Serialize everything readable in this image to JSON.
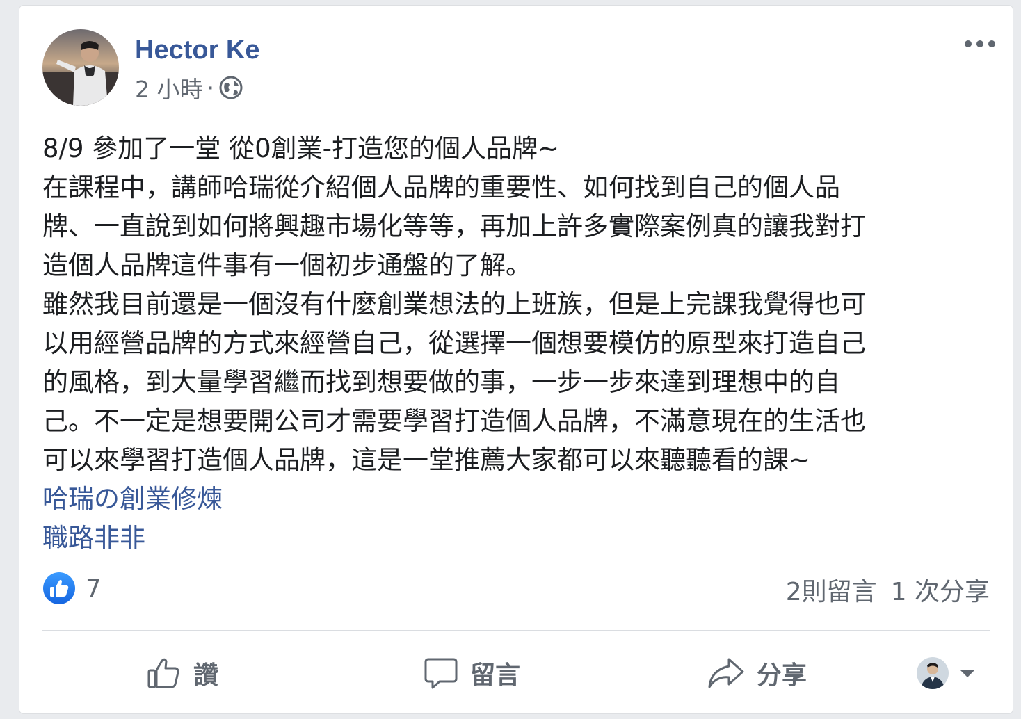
{
  "post": {
    "author": "Hector Ke",
    "time": "2 小時",
    "separator": "·",
    "privacy_icon": "globe-icon",
    "more_icon": "more-options-icon",
    "lines": [
      "8/9 參加了一堂 從0創業-打造您的個人品牌~",
      "在課程中，講師哈瑞從介紹個人品牌的重要性、如何找到自己的個人品",
      "牌、一直說到如何將興趣市場化等等，再加上許多實際案例真的讓我對打",
      "造個人品牌這件事有一個初步通盤的了解。",
      "雖然我目前還是一個沒有什麼創業想法的上班族，但是上完課我覺得也可",
      "以用經營品牌的方式來經營自己，從選擇一個想要模仿的原型來打造自己",
      "的風格，到大量學習繼而找到想要做的事，一步一步來達到理想中的自",
      "己。不一定是想要開公司才需要學習打造個人品牌，不滿意現在的生活也",
      "可以來學習打造個人品牌，這是一堂推薦大家都可以來聽聽看的課~"
    ],
    "tags": [
      "哈瑞の創業修煉",
      "職路非非"
    ]
  },
  "stats": {
    "like_count": "7",
    "comments": "2則留言",
    "shares": "1 次分享"
  },
  "actions": {
    "like": "讚",
    "comment": "留言",
    "share": "分享"
  },
  "colors": {
    "link": "#385898",
    "text": "#1c1e21",
    "secondary": "#606770",
    "like_blue": "#1877f2"
  }
}
